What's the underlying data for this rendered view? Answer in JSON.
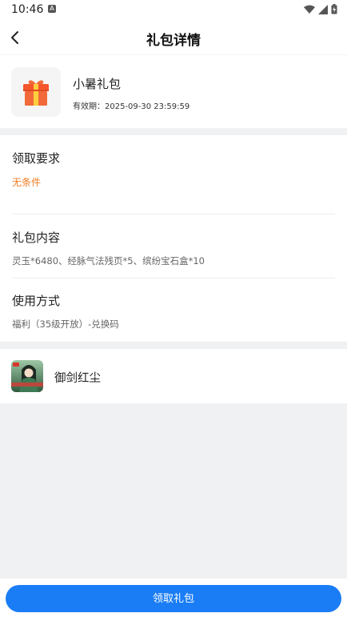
{
  "status_bar": {
    "time": "10:46"
  },
  "header": {
    "title": "礼包详情"
  },
  "gift": {
    "name": "小暑礼包",
    "validity": "有效期：2025-09-30 23:59:59"
  },
  "requirements": {
    "title": "领取要求",
    "value": "无条件"
  },
  "contents": {
    "title": "礼包内容",
    "value": "灵玉*6480、经脉气法残页*5、缤纷宝石盒*10"
  },
  "usage": {
    "title": "使用方式",
    "value": "福利（35级开放）-兑换码"
  },
  "game": {
    "name": "御剑红尘"
  },
  "footer": {
    "claim_label": "领取礼包"
  },
  "colors": {
    "accent": "#1a7df5",
    "condition": "#f07d22"
  }
}
